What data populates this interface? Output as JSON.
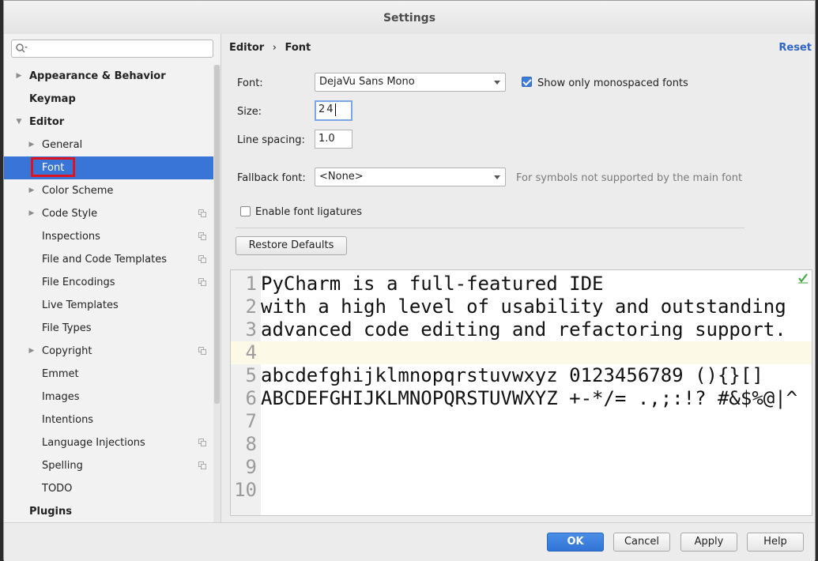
{
  "window": {
    "title": "Settings"
  },
  "search": {
    "placeholder": ""
  },
  "sidebar": {
    "items": [
      {
        "label": "Appearance & Behavior",
        "level": 0,
        "expandable": true,
        "expanded": false,
        "selected": false,
        "copy_icon": false
      },
      {
        "label": "Keymap",
        "level": 0,
        "expandable": false,
        "expanded": false,
        "selected": false,
        "copy_icon": false
      },
      {
        "label": "Editor",
        "level": 0,
        "expandable": true,
        "expanded": true,
        "selected": false,
        "copy_icon": false
      },
      {
        "label": "General",
        "level": 1,
        "expandable": true,
        "expanded": false,
        "selected": false,
        "copy_icon": false
      },
      {
        "label": "Font",
        "level": 1,
        "expandable": false,
        "expanded": false,
        "selected": true,
        "copy_icon": false
      },
      {
        "label": "Color Scheme",
        "level": 1,
        "expandable": true,
        "expanded": false,
        "selected": false,
        "copy_icon": false
      },
      {
        "label": "Code Style",
        "level": 1,
        "expandable": true,
        "expanded": false,
        "selected": false,
        "copy_icon": true
      },
      {
        "label": "Inspections",
        "level": 1,
        "expandable": false,
        "expanded": false,
        "selected": false,
        "copy_icon": true
      },
      {
        "label": "File and Code Templates",
        "level": 1,
        "expandable": false,
        "expanded": false,
        "selected": false,
        "copy_icon": true
      },
      {
        "label": "File Encodings",
        "level": 1,
        "expandable": false,
        "expanded": false,
        "selected": false,
        "copy_icon": true
      },
      {
        "label": "Live Templates",
        "level": 1,
        "expandable": false,
        "expanded": false,
        "selected": false,
        "copy_icon": false
      },
      {
        "label": "File Types",
        "level": 1,
        "expandable": false,
        "expanded": false,
        "selected": false,
        "copy_icon": false
      },
      {
        "label": "Copyright",
        "level": 1,
        "expandable": true,
        "expanded": false,
        "selected": false,
        "copy_icon": true
      },
      {
        "label": "Emmet",
        "level": 1,
        "expandable": false,
        "expanded": false,
        "selected": false,
        "copy_icon": false
      },
      {
        "label": "Images",
        "level": 1,
        "expandable": false,
        "expanded": false,
        "selected": false,
        "copy_icon": false
      },
      {
        "label": "Intentions",
        "level": 1,
        "expandable": false,
        "expanded": false,
        "selected": false,
        "copy_icon": false
      },
      {
        "label": "Language Injections",
        "level": 1,
        "expandable": false,
        "expanded": false,
        "selected": false,
        "copy_icon": true
      },
      {
        "label": "Spelling",
        "level": 1,
        "expandable": false,
        "expanded": false,
        "selected": false,
        "copy_icon": true
      },
      {
        "label": "TODO",
        "level": 1,
        "expandable": false,
        "expanded": false,
        "selected": false,
        "copy_icon": false
      },
      {
        "label": "Plugins",
        "level": 0,
        "expandable": false,
        "expanded": false,
        "selected": false,
        "copy_icon": false
      }
    ],
    "highlight_color": "#e0141e"
  },
  "breadcrumb": {
    "parent": "Editor",
    "separator": "›",
    "current": "Font"
  },
  "reset_label": "Reset",
  "font": {
    "label": "Font:",
    "value": "DejaVu Sans Mono",
    "monospace_label": "Show only monospaced fonts",
    "monospace_checked": true
  },
  "size": {
    "label": "Size:",
    "value": "24"
  },
  "line_spacing": {
    "label": "Line spacing:",
    "value": "1.0"
  },
  "fallback": {
    "label": "Fallback font:",
    "value": "<None>",
    "hint": "For symbols not supported by the main font"
  },
  "ligatures": {
    "label": "Enable font ligatures",
    "checked": false
  },
  "restore_label": "Restore Defaults",
  "preview": {
    "lines": [
      {
        "num": "1",
        "text": "PyCharm is a full-featured IDE"
      },
      {
        "num": "2",
        "text": "with a high level of usability and outstanding"
      },
      {
        "num": "3",
        "text": "advanced code editing and refactoring support."
      },
      {
        "num": "4",
        "text": ""
      },
      {
        "num": "5",
        "text": "abcdefghijklmnopqrstuvwxyz 0123456789 (){}[]"
      },
      {
        "num": "6",
        "text": "ABCDEFGHIJKLMNOPQRSTUVWXYZ +-*/= .,;:!? #&$%@|^"
      },
      {
        "num": "7",
        "text": ""
      },
      {
        "num": "8",
        "text": ""
      },
      {
        "num": "9",
        "text": ""
      },
      {
        "num": "10",
        "text": ""
      }
    ],
    "current_line": 4
  },
  "buttons": {
    "ok": "OK",
    "cancel": "Cancel",
    "apply": "Apply",
    "help": "Help"
  },
  "colors": {
    "selection": "#3875d7",
    "link": "#2f65ca",
    "primary_button": "#3a7fdc"
  }
}
